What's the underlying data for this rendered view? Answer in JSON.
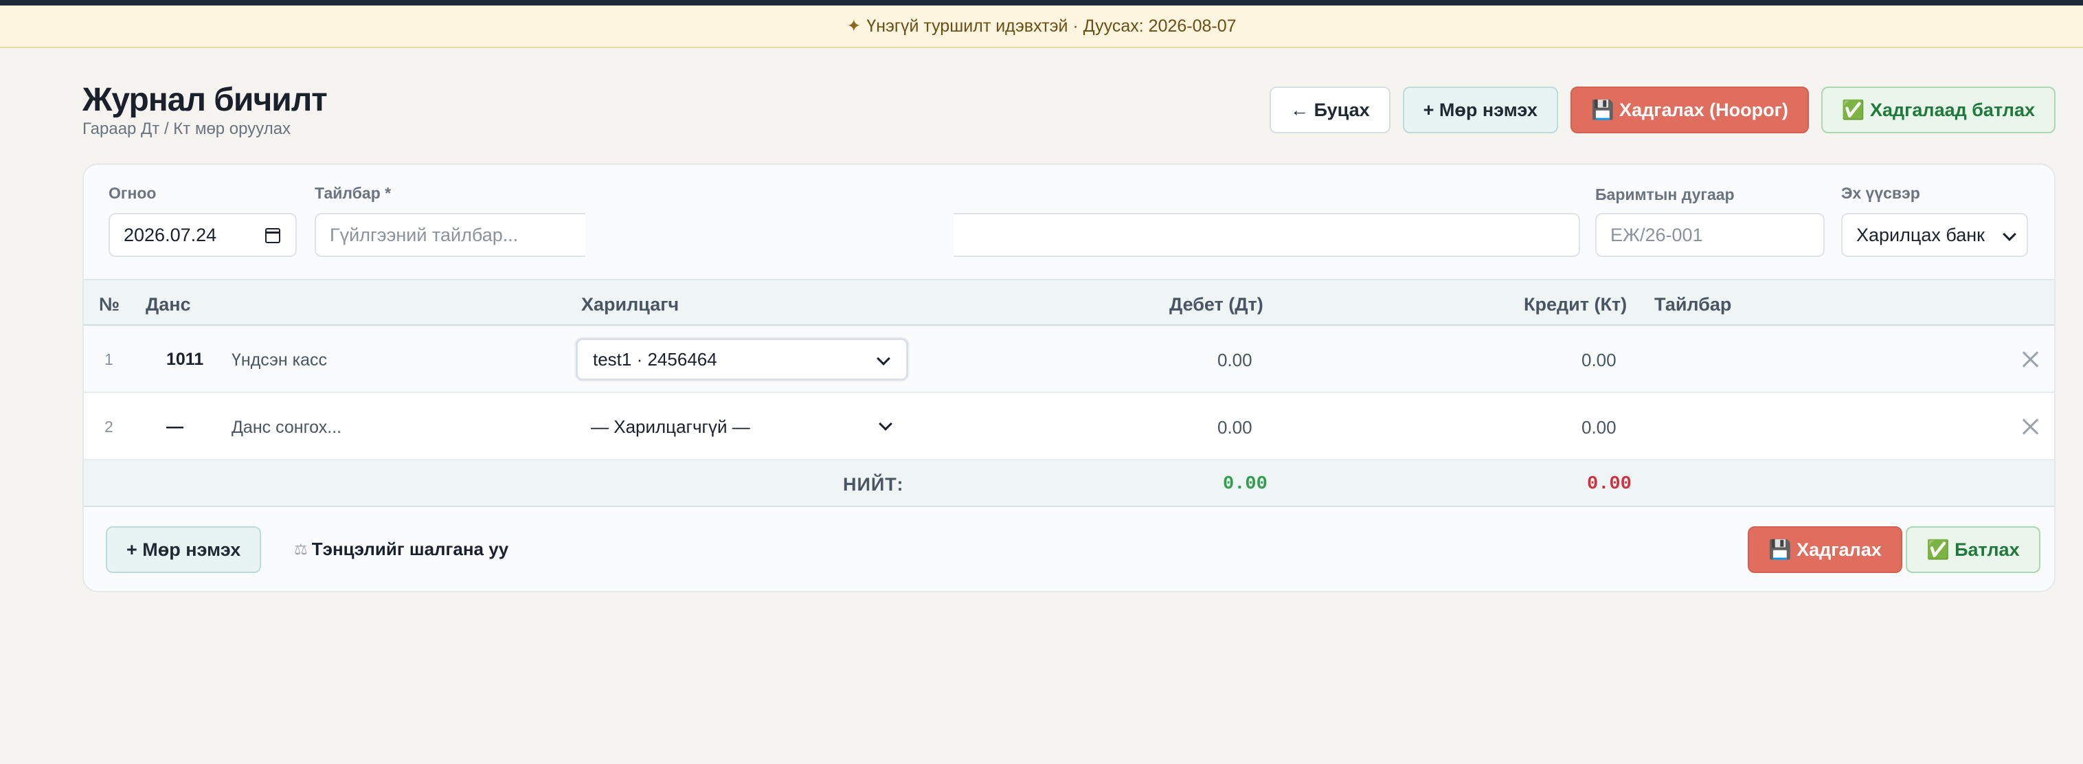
{
  "banner": {
    "icon": "sparkle-icon",
    "text": "Үнэгүй туршилт идэвхтэй · Дуусах: 2026-08-07"
  },
  "header": {
    "title": "Журнал бичилт",
    "subtitle": "Гараар Дт / Кт мөр оруулах",
    "actions": {
      "back": "← Буцах",
      "add_row": "+ Мөр нэмэх",
      "save_draft": "💾 Хадгалах (Ноорог)",
      "save_approve": "✅ Хадгалаад батлах"
    }
  },
  "form": {
    "date_label": "Огноо",
    "date_value": "2026.07.24",
    "description_label": "Тайлбар *",
    "description_placeholder": "Гүйлгээний тайлбар...",
    "document_label": "Баримтын дугаар",
    "document_placeholder": "ЕЖ/26-001",
    "source_label": "Эх үүсвэр",
    "source_value": "Харилцах банк"
  },
  "table": {
    "columns": {
      "num": "№",
      "account": "Данс",
      "party": "Харилцагч",
      "debit": "Дебет (Дт)",
      "credit": "Кредит (Кт)",
      "note": "Тайлбар"
    },
    "rows": [
      {
        "num": "1",
        "code": "1011",
        "name": "Үндсэн касс",
        "party": "test1 · 2456464",
        "debit": "0.00",
        "credit": "0.00"
      },
      {
        "num": "2",
        "code": "—",
        "name": "Данс сонгох...",
        "party": "— Харилцагчгүй —",
        "debit": "0.00",
        "credit": "0.00"
      }
    ],
    "total": {
      "label": "НИЙТ:",
      "debit": "0.00",
      "credit": "0.00"
    }
  },
  "footer": {
    "add_row": "+ Мөр нэмэх",
    "balance_check": "Тэнцэлийг шалгана уу",
    "save": "💾 Хадгалах",
    "approve": "✅ Батлах"
  },
  "colors": {
    "debit_total": "#2f9e4f",
    "credit_total": "#d0303f",
    "primary_red": "#e06e5e"
  }
}
